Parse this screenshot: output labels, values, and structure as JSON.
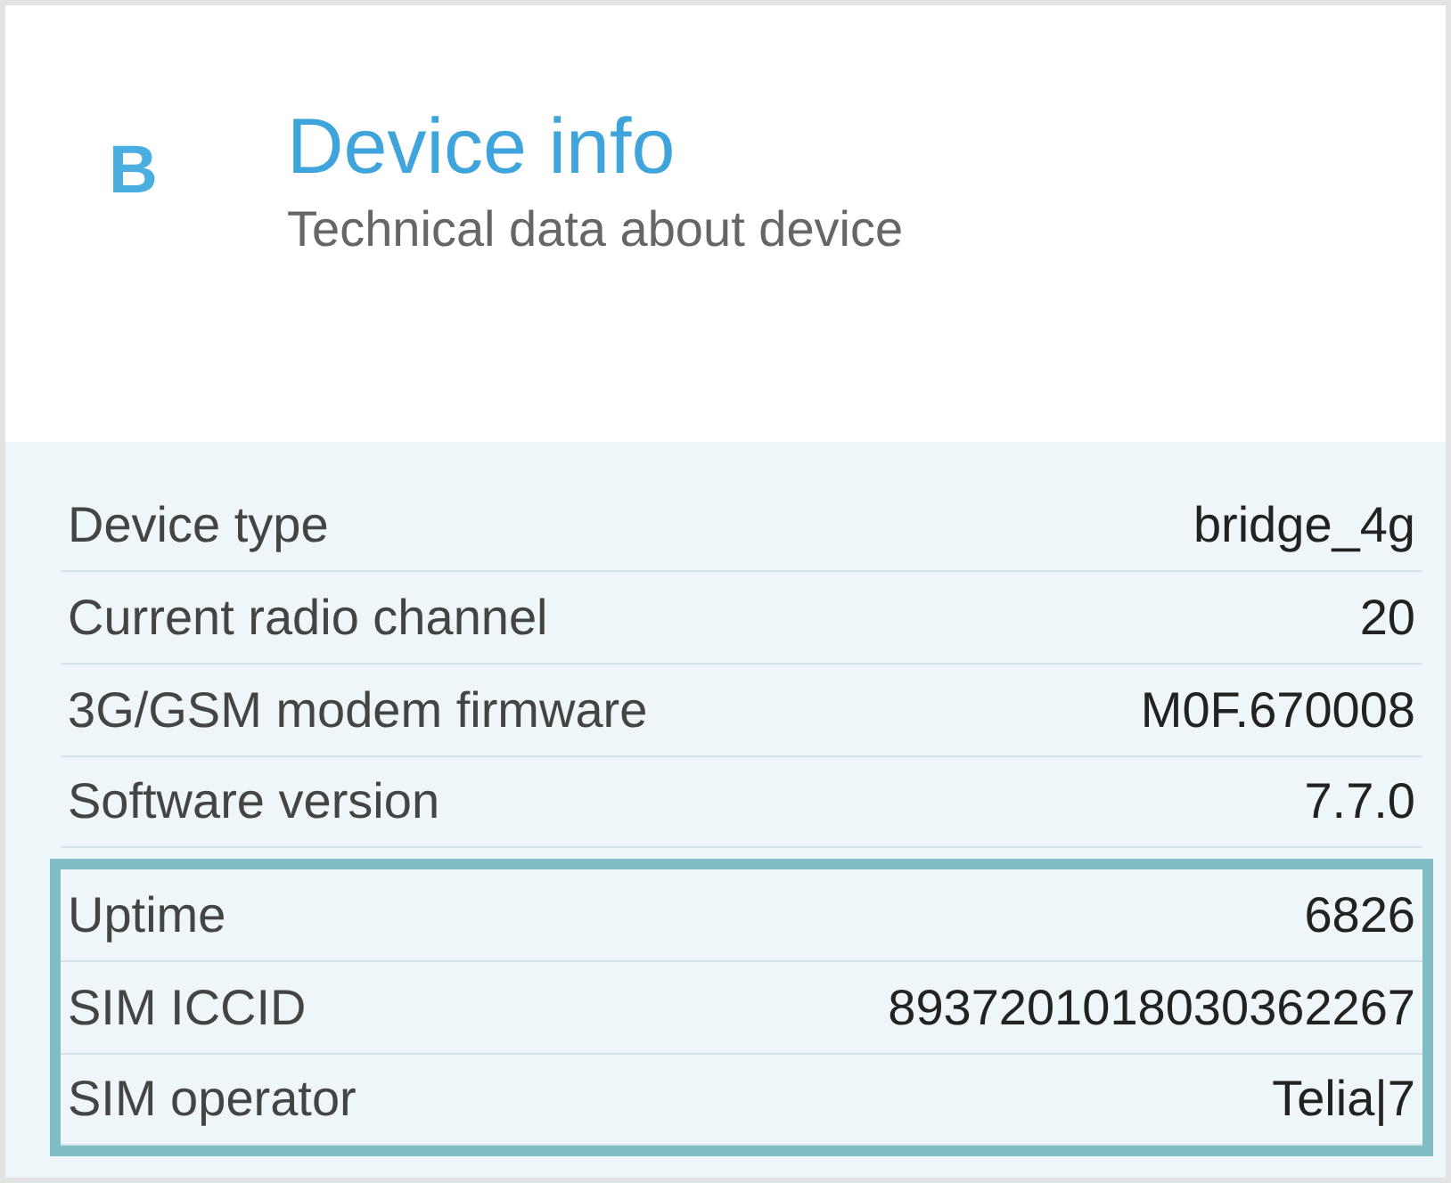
{
  "header": {
    "logo": "B",
    "title": "Device info",
    "subtitle": "Technical data about device"
  },
  "rows": [
    {
      "label": "Device type",
      "value": "bridge_4g",
      "highlighted": false
    },
    {
      "label": "Current radio channel",
      "value": "20",
      "highlighted": false
    },
    {
      "label": "3G/GSM modem firmware",
      "value": "M0F.670008",
      "highlighted": false
    },
    {
      "label": "Software version",
      "value": "7.7.0",
      "highlighted": false
    },
    {
      "label": "Uptime",
      "value": "6826",
      "highlighted": true
    },
    {
      "label": "SIM ICCID",
      "value": "8937201018030362267",
      "highlighted": true
    },
    {
      "label": "SIM operator",
      "value": "Telia|7",
      "highlighted": true
    }
  ]
}
